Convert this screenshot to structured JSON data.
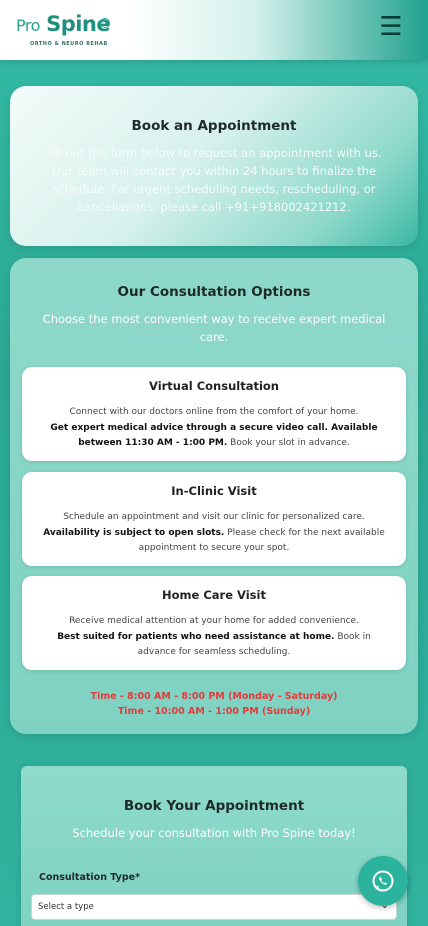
{
  "header": {
    "logo_pro": "Pro",
    "logo_spine": "Spine",
    "logo_tm": "TM",
    "logo_sub": "ORTHO & NEURO REHAB",
    "menu_icon": "☰"
  },
  "book_intro": {
    "title": "Book an Appointment",
    "body": "Fill out the form below to request an appointment with us. Our team will contact you within 24 hours to finalize the schedule. For urgent scheduling needs, rescheduling, or cancellations, please call +91+918002421212."
  },
  "consultation": {
    "title": "Our Consultation Options",
    "subtitle": "Choose the most convenient way to receive expert medical care.",
    "options": [
      {
        "title": "Virtual Consultation",
        "line1": "Connect with our doctors online from the comfort of your home.",
        "bold": "Get expert medical advice through a secure video call. Available between 11:30 AM - 1:00 PM.",
        "tail": " Book your slot in advance."
      },
      {
        "title": "In-Clinic Visit",
        "line1": "Schedule an appointment and visit our clinic for personalized care.",
        "bold": "Availability is subject to open slots.",
        "tail": " Please check for the next available appointment to secure your spot."
      },
      {
        "title": "Home Care Visit",
        "line1": "Receive medical attention at your home for added convenience.",
        "bold": "Best suited for patients who need assistance at home.",
        "tail": " Book in advance for seamless scheduling."
      }
    ],
    "timing_weekday": "Time - 8:00 AM - 8:00 PM (Monday - Saturday)",
    "timing_sunday": "Time - 10:00 AM - 1:00 PM (Sunday)"
  },
  "form": {
    "title": "Book Your Appointment",
    "subtitle": "Schedule your consultation with Pro Spine today!",
    "consultation_type_label": "Consultation Type*",
    "consultation_type_value": "Select a type"
  },
  "icons": {
    "whatsapp": "whatsapp-icon",
    "menu": "hamburger-menu-icon",
    "chevron": "chevron-down-icon"
  },
  "colors": {
    "brand_teal": "#2aa893",
    "timing_red": "#e23c3c"
  }
}
